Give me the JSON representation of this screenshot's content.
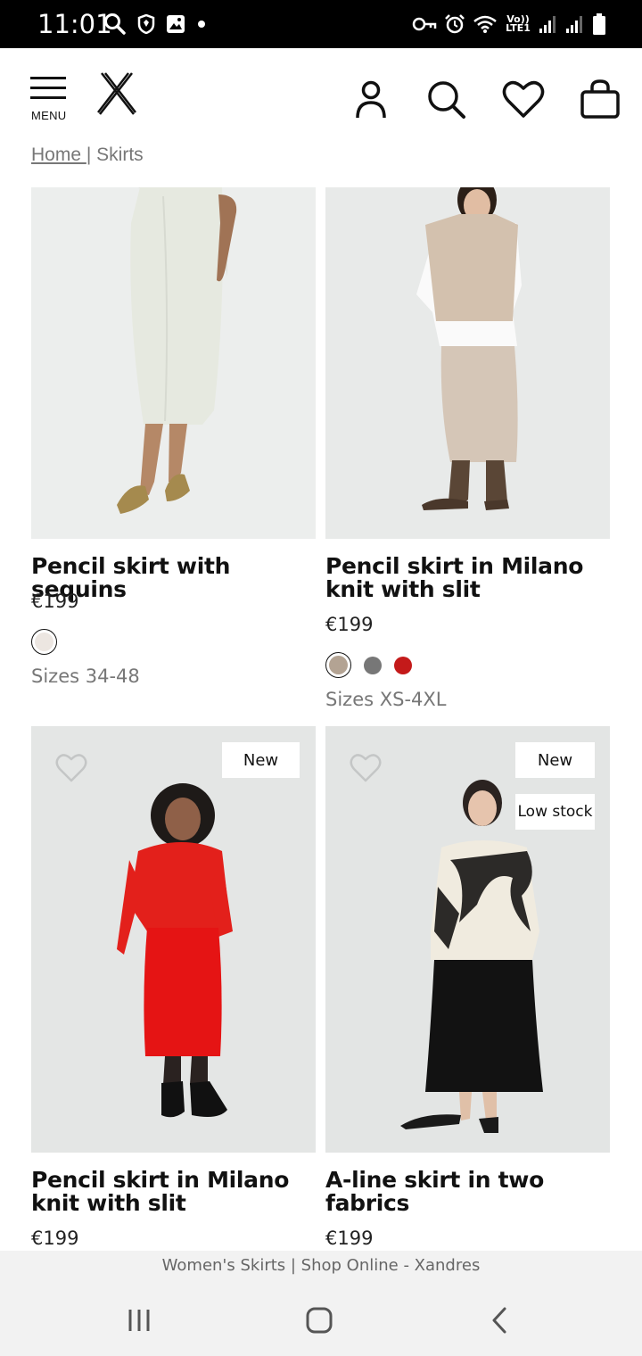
{
  "status_bar": {
    "time": "11:01",
    "network_label": "Vo)) LTE1"
  },
  "header": {
    "menu_label": "MENU"
  },
  "breadcrumb": {
    "home": "Home ",
    "separator": "|",
    "current": " Skirts"
  },
  "products": [
    {
      "title": "Pencil skirt with sequins",
      "price": "€199",
      "sizes": "Sizes 34-48",
      "swatches": [
        "#ece6e1"
      ],
      "skirt_color": "#e8ebe2"
    },
    {
      "title": "Pencil skirt in Milano knit with slit",
      "price": "€199",
      "sizes": "Sizes XS-4XL",
      "swatches": [
        "#b3a393",
        "#777777",
        "#c41a1a"
      ],
      "skirt_color": "#d6c7b9"
    },
    {
      "title": "Pencil skirt in Milano knit with slit",
      "price": "€199",
      "badges": [
        "New"
      ],
      "skirt_color": "#e51414"
    },
    {
      "title": "A-line skirt in two fabrics",
      "price": "€199",
      "badges": [
        "New",
        "Low stock"
      ],
      "skirt_color": "#121212"
    }
  ],
  "browser": {
    "page_title": "Women's Skirts | Shop Online - Xandres"
  }
}
